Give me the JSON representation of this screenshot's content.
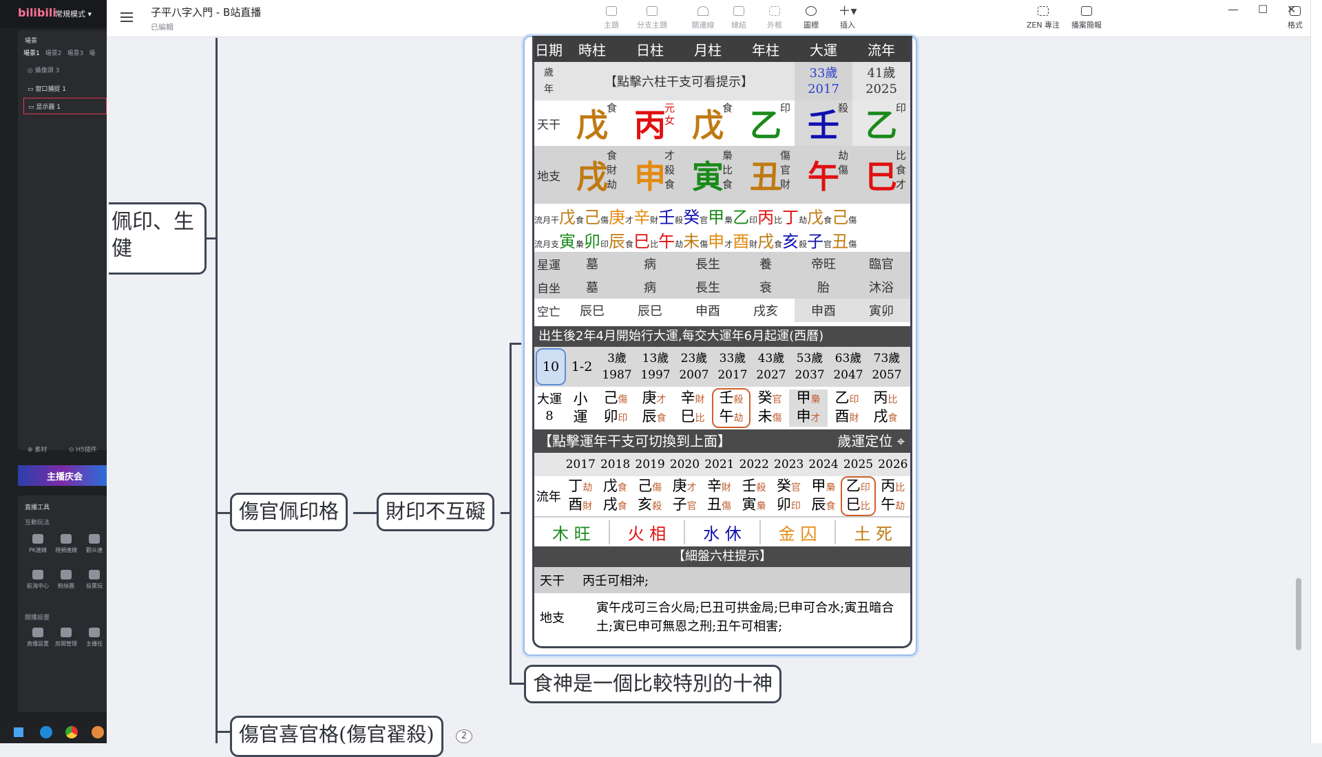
{
  "left_panel": {
    "logo": "bilibili",
    "mode": "常規模式 ▾",
    "scenes_title": "場景",
    "scene_tabs": [
      "場景1",
      "場景2",
      "場景3",
      "場"
    ],
    "camera_item": "攝像頭 3",
    "source_items": [
      "窗口捕捉 1",
      "显示器 1"
    ],
    "bottom_links": [
      "素材",
      "H5插件"
    ],
    "banner_text": "主播庆会",
    "tools_title": "直播工具",
    "tools_sub": "互動玩法",
    "tools_row1": [
      "PK連線",
      "視頻連線",
      "觀众連"
    ],
    "tools_row2": [
      "航海中心",
      "粉絲團",
      "投票玩"
    ],
    "settings_title": "開播設置",
    "settings_row": [
      "直播設置",
      "房間管理",
      "主播任"
    ]
  },
  "titlebar": {
    "title": "子平八字入門 - B站直播",
    "subtitle": "已編輯",
    "buttons": [
      "主題",
      "分支主題",
      "關連線",
      "總結",
      "外框",
      "圖標",
      "插入"
    ],
    "right_buttons": [
      "ZEN 專注",
      "播案簡報",
      "格式"
    ]
  },
  "mindmap": {
    "node_left": "佩印、生\n健",
    "node_shangguan": "傷官佩印格",
    "node_caiyin": "財印不互礙",
    "node_shishen": "食神是一個比較特別的十神",
    "node_bottom": "傷官喜官格(傷官翟殺)",
    "badge": "2"
  },
  "bazi": {
    "headers": [
      "日期",
      "時柱",
      "日柱",
      "月柱",
      "年柱",
      "大運",
      "流年"
    ],
    "age_label": "歲\n年",
    "click_hint": "【點擊六柱干支可看提示】",
    "dayun_age": "33歲",
    "dayun_year": "2017",
    "liunian_age": "41歲",
    "liunian_year": "2025",
    "tiangan_label": "天干",
    "tiangan": [
      {
        "char": "戊",
        "note": "食",
        "color": "#c07a10"
      },
      {
        "char": "丙",
        "note": "元\n女",
        "color": "#e01010"
      },
      {
        "char": "戊",
        "note": "食",
        "color": "#c07a10"
      },
      {
        "char": "乙",
        "note": "印",
        "color": "#1a8a1a"
      },
      {
        "char": "壬",
        "note": "殺",
        "color": "#1010b0"
      },
      {
        "char": "乙",
        "note": "印",
        "color": "#1a8a1a"
      }
    ],
    "dizhi_label": "地支",
    "dizhi": [
      {
        "char": "戌",
        "note": "食\n財\n劫",
        "color": "#c07a10"
      },
      {
        "char": "申",
        "note": "才\n殺\n食",
        "color": "#e38a10"
      },
      {
        "char": "寅",
        "note": "梟\n比\n食",
        "color": "#1a8a1a"
      },
      {
        "char": "丑",
        "note": "傷\n官\n財",
        "color": "#c07a10"
      },
      {
        "char": "午",
        "note": "劫\n傷",
        "color": "#e01010"
      },
      {
        "char": "巳",
        "note": "比\n食\n才",
        "color": "#e01010"
      }
    ],
    "flow_gan_label": "流月干",
    "flow_gan": "戊食己傷庚才辛財壬殺癸官甲梟乙印丙比丁劫戊食己傷",
    "flow_zhi_label": "流月支",
    "flow_zhi": "寅梟卯印辰食巳比午劫未傷申才酉財戌食亥殺子官丑傷",
    "xingyun_label": "星運",
    "xingyun": [
      "墓",
      "病",
      "長生",
      "養",
      "帝旺",
      "臨官"
    ],
    "zizuo_label": "自坐",
    "zizuo": [
      "墓",
      "病",
      "長生",
      "衰",
      "胎",
      "沐浴"
    ],
    "kongwang_label": "空亡",
    "kongwang": [
      "辰巳",
      "辰巳",
      "申酉",
      "戌亥",
      "申酉",
      "寅卯"
    ],
    "dayun_intro": "出生後2年4月開始行大運,每交大運年6月起運(西曆)",
    "dayun_ages": [
      "10",
      "1-2",
      "3歲\n1987",
      "13歲\n1997",
      "23歲\n2007",
      "33歲\n2017",
      "43歲\n2027",
      "53歲\n2037",
      "63歲\n2047",
      "73歲\n2057"
    ],
    "dayun_label": "大運\n8",
    "xiaoyun": "小\n運",
    "dayun_pillars": [
      {
        "g": "己",
        "gn": "傷",
        "z": "卯",
        "zn": "印"
      },
      {
        "g": "庚",
        "gn": "才",
        "z": "辰",
        "zn": "食"
      },
      {
        "g": "辛",
        "gn": "財",
        "z": "巳",
        "zn": "比"
      },
      {
        "g": "壬",
        "gn": "殺",
        "z": "午",
        "zn": "劫"
      },
      {
        "g": "癸",
        "gn": "官",
        "z": "未",
        "zn": "傷"
      },
      {
        "g": "甲",
        "gn": "梟",
        "z": "申",
        "zn": "才"
      },
      {
        "g": "乙",
        "gn": "印",
        "z": "酉",
        "zn": "財"
      },
      {
        "g": "丙",
        "gn": "比",
        "z": "戌",
        "zn": "食"
      }
    ],
    "switch_hint": "【點擊運年干支可切換到上面】",
    "locate_label": "歲運定位",
    "liunian_years": [
      "2017",
      "2018",
      "2019",
      "2020",
      "2021",
      "2022",
      "2023",
      "2024",
      "2025",
      "2026"
    ],
    "liunian_label": "流年",
    "liunian_pillars": [
      {
        "g": "丁",
        "gn": "劫",
        "z": "酉",
        "zn": "財"
      },
      {
        "g": "戊",
        "gn": "食",
        "z": "戌",
        "zn": "食"
      },
      {
        "g": "己",
        "gn": "傷",
        "z": "亥",
        "zn": "殺"
      },
      {
        "g": "庚",
        "gn": "才",
        "z": "子",
        "zn": "官"
      },
      {
        "g": "辛",
        "gn": "財",
        "z": "丑",
        "zn": "傷"
      },
      {
        "g": "壬",
        "gn": "殺",
        "z": "寅",
        "zn": "梟"
      },
      {
        "g": "癸",
        "gn": "官",
        "z": "卯",
        "zn": "印"
      },
      {
        "g": "甲",
        "gn": "梟",
        "z": "辰",
        "zn": "食"
      },
      {
        "g": "乙",
        "gn": "印",
        "z": "巳",
        "zn": "比"
      },
      {
        "g": "丙",
        "gn": "比",
        "z": "午",
        "zn": "劫"
      }
    ],
    "wuxing": [
      {
        "el": "木",
        "st": "旺",
        "color": "#1a8a1a"
      },
      {
        "el": "火",
        "st": "相",
        "color": "#e01010"
      },
      {
        "el": "水",
        "st": "休",
        "color": "#1010b0"
      },
      {
        "el": "金",
        "st": "囚",
        "color": "#e38a10"
      },
      {
        "el": "土",
        "st": "死",
        "color": "#c07a10"
      }
    ],
    "detail_title": "【細盤六柱提示】",
    "detail_tiangan_label": "天干",
    "detail_tiangan": "丙壬可相沖;",
    "detail_dizhi_label": "地支",
    "detail_dizhi": "寅午戌可三合火局;巳丑可拱金局;巳申可合水;寅丑暗合土;寅巳申可無恩之刑;丑午可相害;"
  }
}
